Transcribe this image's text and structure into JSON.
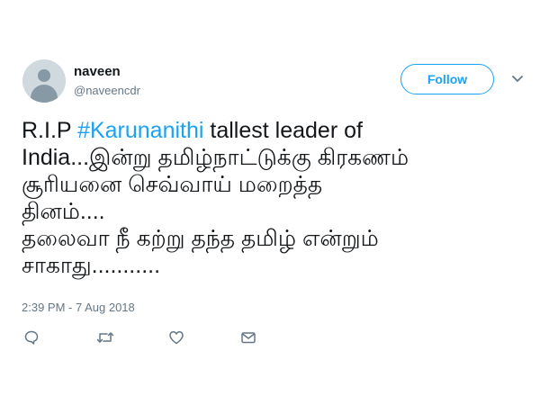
{
  "user": {
    "display_name": "naveen",
    "handle": "@naveencdr"
  },
  "follow_button": {
    "label": "Follow"
  },
  "tweet": {
    "text_prefix": "R.I.P ",
    "hashtag": "#Karunanithi",
    "text_rest": " tallest leader of\nIndia...இன்று தமிழ்நாட்டுக்கு கிரகணம்\nசூரியனை செவ்வாய் மறைத்த\nதினம்....\nதலைவா நீ கற்று தந்த தமிழ் என்றும்\nசாகாது...........",
    "timestamp": "2:39 PM - 7 Aug 2018"
  },
  "actions": {
    "icons": [
      "reply-icon",
      "retweet-icon",
      "like-icon",
      "message-icon"
    ]
  },
  "colors": {
    "accent": "#1da1f2",
    "text": "#14171a",
    "secondary": "#657786"
  }
}
